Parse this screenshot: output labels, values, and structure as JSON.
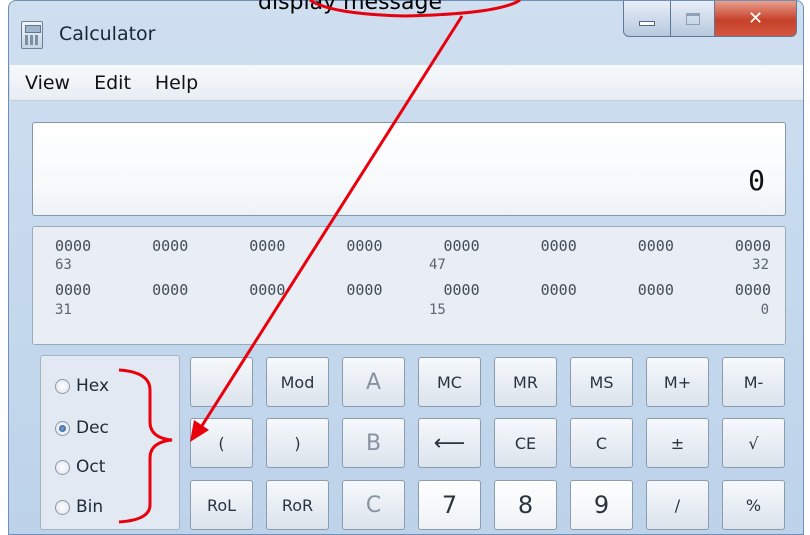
{
  "window": {
    "title": "Calculator",
    "colors": {
      "close": "#c6412a",
      "annotation": "#e8000d",
      "chrome": "#bdd3ea"
    }
  },
  "menu": {
    "items": [
      "View",
      "Edit",
      "Help"
    ]
  },
  "display": {
    "value": "0"
  },
  "bits": {
    "row1": [
      "0000",
      "0000",
      "0000",
      "0000",
      "0000",
      "0000",
      "0000",
      "0000"
    ],
    "row1_positions": [
      "63",
      "47",
      "32"
    ],
    "row2": [
      "0000",
      "0000",
      "0000",
      "0000",
      "0000",
      "0000",
      "0000",
      "0000"
    ],
    "row2_positions": [
      "31",
      "15",
      "0"
    ]
  },
  "base": {
    "options": [
      "Hex",
      "Dec",
      "Oct",
      "Bin"
    ],
    "selected": "Dec"
  },
  "keys": {
    "blank": "",
    "mod": "Mod",
    "a": "A",
    "mc": "MC",
    "mr": "MR",
    "ms": "MS",
    "mplus": "M+",
    "mminus": "M-",
    "lparen": "(",
    "rparen": ")",
    "b": "B",
    "backspace": "⟵",
    "ce": "CE",
    "c": "C",
    "plusminus": "±",
    "sqrt": "√",
    "rol": "RoL",
    "ror": "RoR",
    "hex_c": "C",
    "seven": "7",
    "eight": "8",
    "nine": "9",
    "divide": "/",
    "percent": "%"
  },
  "annotation": {
    "fragment": "display message"
  }
}
